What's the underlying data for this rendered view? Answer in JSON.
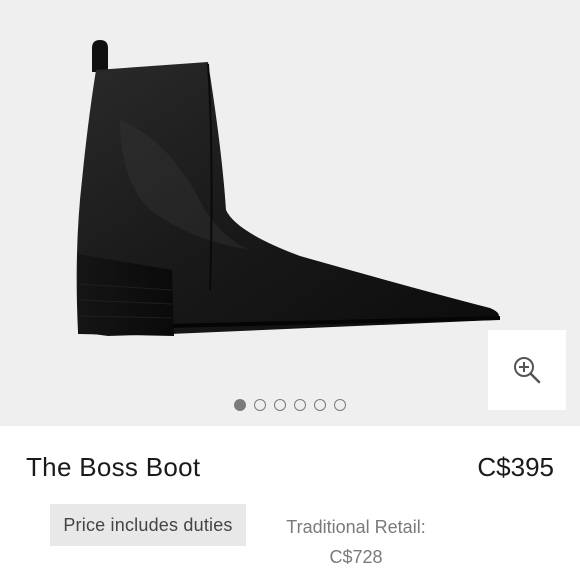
{
  "product": {
    "title": "The Boss Boot",
    "price": "C$395",
    "duties_label": "Price includes duties",
    "traditional_retail_label": "Traditional Retail:",
    "traditional_retail_price": "C$728"
  },
  "gallery": {
    "image_count": 6,
    "active_index": 0,
    "zoom_icon": "zoom-in-icon"
  },
  "colors": {
    "background": "#efefef",
    "text": "#1a1a1a",
    "muted": "#7a7a7a",
    "badge": "#e8e8e8"
  }
}
